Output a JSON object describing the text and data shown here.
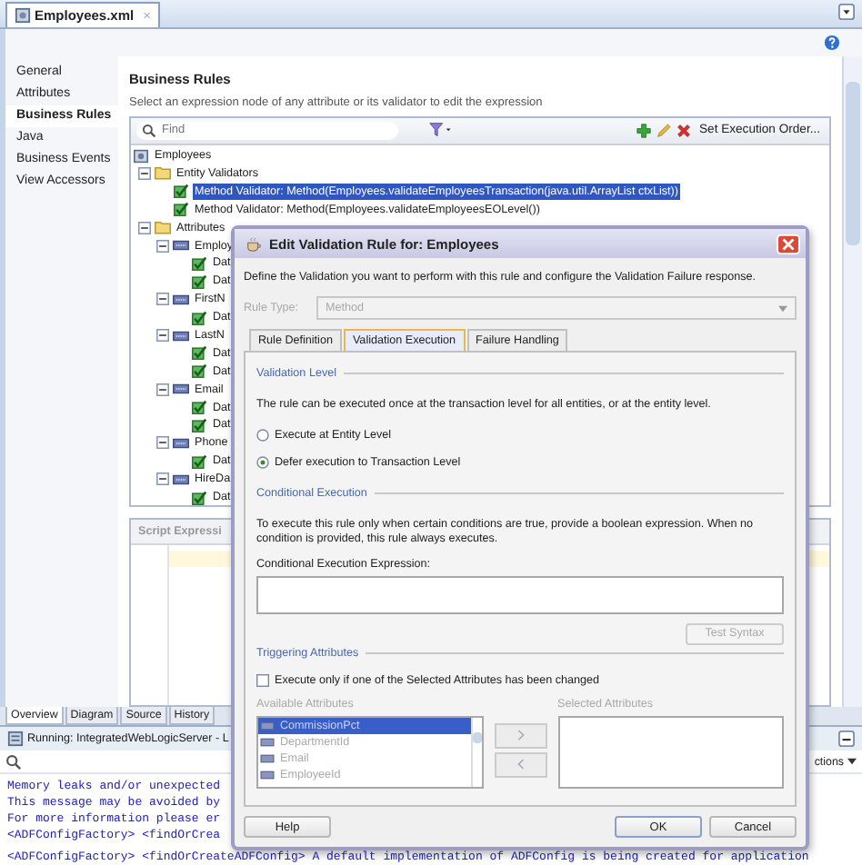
{
  "editor_tab": {
    "label": "Employees.xml",
    "close": "×"
  },
  "nav": [
    {
      "label": "General",
      "selected": false
    },
    {
      "label": "Attributes",
      "selected": false
    },
    {
      "label": "Business Rules",
      "selected": true
    },
    {
      "label": "Java",
      "selected": false
    },
    {
      "label": "Business Events",
      "selected": false
    },
    {
      "label": "View Accessors",
      "selected": false
    }
  ],
  "section": {
    "title": "Business Rules",
    "subtitle": "Select an expression node of any attribute or its validator to edit the expression"
  },
  "tree_toolbar": {
    "search_placeholder": "Find",
    "order_button": "Set Execution Order..."
  },
  "tree": [
    {
      "label": "Employees",
      "kind": "entity",
      "selected": false,
      "children": [
        {
          "label": "Entity Validators",
          "kind": "folder",
          "selected": false,
          "expanded": true,
          "children": [
            {
              "label": "Method Validator: Method(Employees.validateEmployeesTransaction(java.util.ArrayList ctxList))",
              "kind": "validator",
              "selected": true
            },
            {
              "label": "Method Validator: Method(Employees.validateEmployeesEOLevel())",
              "kind": "validator",
              "selected": false
            }
          ]
        },
        {
          "label": "Attributes",
          "kind": "folder",
          "selected": false,
          "expanded": true,
          "children": [
            {
              "label": "Employ",
              "kind": "attribute",
              "selected": false,
              "expanded": true,
              "children": [
                {
                  "label": "Dat",
                  "kind": "validator",
                  "selected": false
                },
                {
                  "label": "Dat",
                  "kind": "validator",
                  "selected": false
                }
              ]
            },
            {
              "label": "FirstN",
              "kind": "attribute",
              "selected": false,
              "expanded": true,
              "children": [
                {
                  "label": "Dat",
                  "kind": "validator",
                  "selected": false
                }
              ]
            },
            {
              "label": "LastN",
              "kind": "attribute",
              "selected": false,
              "expanded": true,
              "children": [
                {
                  "label": "Dat",
                  "kind": "validator",
                  "selected": false
                },
                {
                  "label": "Dat",
                  "kind": "validator",
                  "selected": false
                }
              ]
            },
            {
              "label": "Email",
              "kind": "attribute",
              "selected": false,
              "expanded": true,
              "children": [
                {
                  "label": "Dat",
                  "kind": "validator",
                  "selected": false
                },
                {
                  "label": "Dat",
                  "kind": "validator",
                  "selected": false
                }
              ]
            },
            {
              "label": "Phone",
              "kind": "attribute",
              "selected": false,
              "expanded": true,
              "children": [
                {
                  "label": "Dat",
                  "kind": "validator",
                  "selected": false
                }
              ]
            },
            {
              "label": "HireDa",
              "kind": "attribute",
              "selected": false,
              "expanded": true,
              "children": [
                {
                  "label": "Dat",
                  "kind": "validator",
                  "selected": false
                }
              ]
            }
          ]
        }
      ]
    }
  ],
  "script_panel": {
    "title": "Script Expressi"
  },
  "bottom_tabs": [
    {
      "label": "Overview",
      "selected": true
    },
    {
      "label": "Diagram",
      "selected": false
    },
    {
      "label": "Source",
      "selected": false
    },
    {
      "label": "History",
      "selected": false
    }
  ],
  "log": {
    "title": "Running: IntegratedWebLogicServer - L",
    "actions": "ctions",
    "lines": [
      "Memory leaks and/or unexpected",
      "This message may be avoided by",
      "For more information please er",
      "<ADFConfigFactory> <findOrCrea",
      "<ADFConfigFactory> <findOrCreateADFConfig> A default implementation of ADFConfig is being created for application"
    ]
  },
  "dialog": {
    "title": "Edit Validation Rule for: Employees",
    "description": "Define the Validation you want to perform with this rule and configure the Validation Failure response.",
    "rule_type": {
      "label": "Rule Type:",
      "value": "Method",
      "disabled": true
    },
    "tabs": [
      {
        "label": "Rule Definition",
        "selected": false
      },
      {
        "label": "Validation Execution",
        "selected": true
      },
      {
        "label": "Failure Handling",
        "selected": false
      }
    ],
    "validation_level": {
      "legend": "Validation Level",
      "text": "The rule can be executed once at the transaction level for all entities, or at the entity level.",
      "options": [
        {
          "label": "Execute at Entity Level",
          "selected": false
        },
        {
          "label": "Defer execution to Transaction Level",
          "selected": true
        }
      ]
    },
    "conditional": {
      "legend": "Conditional Execution",
      "text": "To execute this rule only when certain conditions are true, provide a boolean expression. When no condition is provided, this rule always executes.",
      "expression_label": "Conditional Execution Expression:",
      "test_button": {
        "label": "Test Syntax",
        "disabled": true
      }
    },
    "triggering": {
      "legend": "Triggering Attributes",
      "checkbox": {
        "label": "Execute only if one of the Selected Attributes has been changed",
        "checked": false
      },
      "available_label": "Available Attributes",
      "selected_label": "Selected Attributes",
      "available": [
        {
          "label": "CommissionPct",
          "selected": true
        },
        {
          "label": "DepartmentId",
          "selected": false
        },
        {
          "label": "Email",
          "selected": false
        },
        {
          "label": "EmployeeId",
          "selected": false
        }
      ]
    },
    "buttons": {
      "help": "Help",
      "ok": "OK",
      "cancel": "Cancel"
    }
  }
}
